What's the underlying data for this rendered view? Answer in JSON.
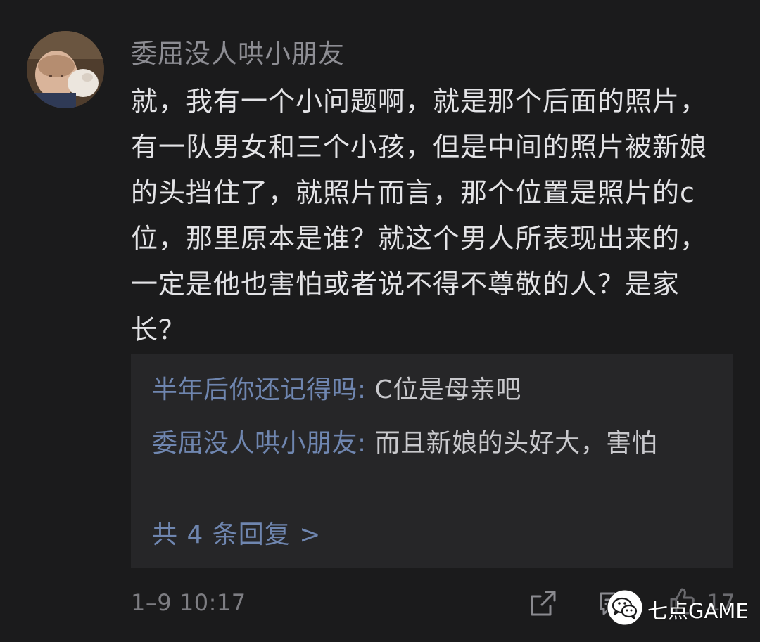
{
  "comment": {
    "username": "委屈没人哄小朋友",
    "text": "就，我有一个小问题啊，就是那个后面的照片，有一队男女和三个小孩，但是中间的照片被新娘的头挡住了，就照片而言，那个位置是照片的c位，那里原本是谁？就这个男人所表现出来的，一定是他也害怕或者说不得不尊敬的人？是家长？",
    "timestamp": "1–9 10:17"
  },
  "replies": [
    {
      "author": "半年后你还记得吗",
      "separator": ": ",
      "text": "C位是母亲吧"
    },
    {
      "author": "委屈没人哄小朋友",
      "separator": ": ",
      "text": "而且新娘的头好大，害怕"
    }
  ],
  "more_replies": "共 4 条回复 >",
  "actions": {
    "share_icon": "share-icon",
    "reply_icon": "comment-icon",
    "like_icon": "thumbs-up-icon",
    "like_count": "17"
  },
  "watermark": {
    "logo_icon": "wechat-logo-icon",
    "text": "七点GAME"
  },
  "colors": {
    "background": "#1b1b1c",
    "reply_panel": "#262628",
    "link_blue": "#6f86b0",
    "text_primary": "#e3e3e6",
    "text_secondary": "#8d8d93"
  }
}
